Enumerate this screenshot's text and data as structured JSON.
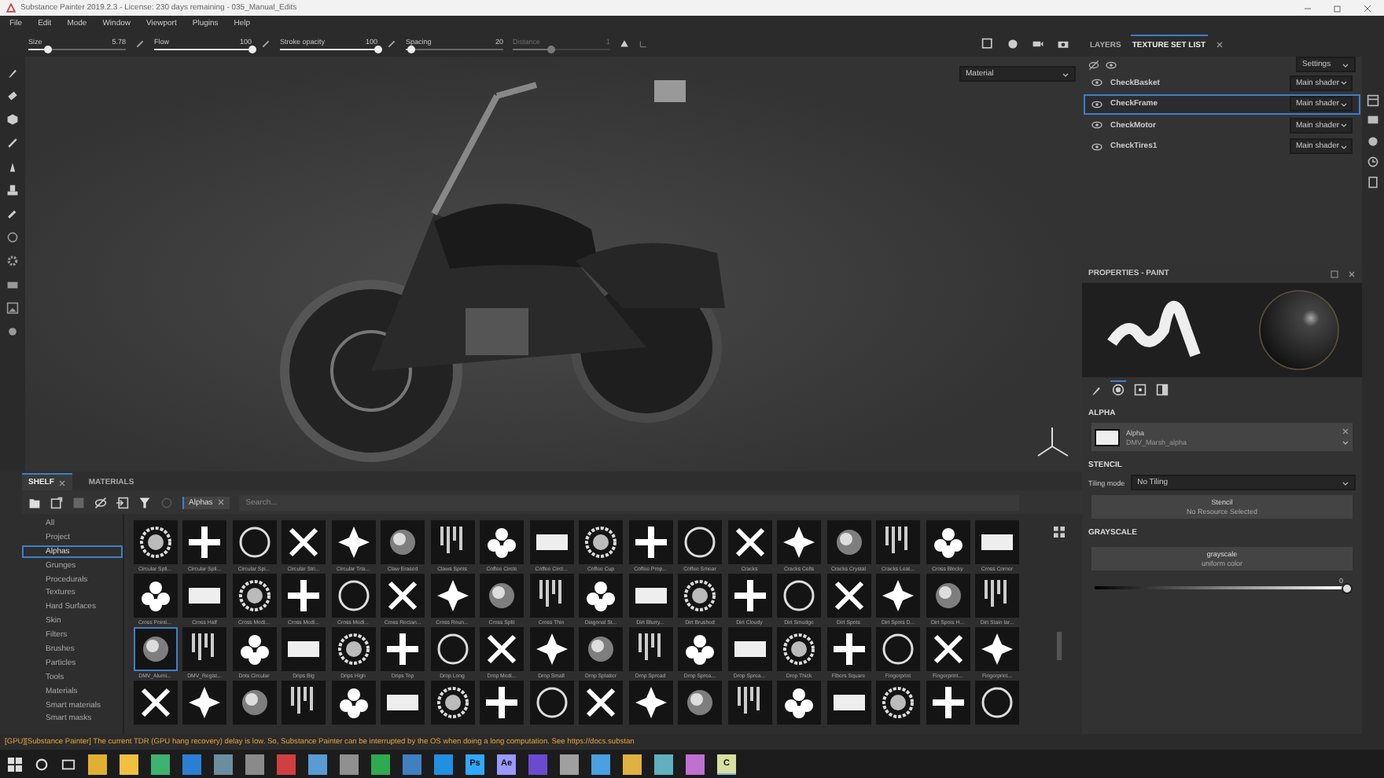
{
  "window": {
    "title": "Substance Painter 2019.2.3 - License: 230 days remaining - 035_Manual_Edits"
  },
  "menu": [
    "File",
    "Edit",
    "Mode",
    "Window",
    "Viewport",
    "Plugins",
    "Help"
  ],
  "toolbar": {
    "sliders": [
      {
        "label": "Size",
        "reading": "5.78",
        "level": 0.2,
        "disabled": false
      },
      {
        "label": "Flow",
        "reading": "100",
        "level": 1,
        "disabled": false
      },
      {
        "label": "Stroke opacity",
        "reading": "100",
        "level": 1,
        "disabled": false
      },
      {
        "label": "Spacing",
        "reading": "20",
        "level": 0.05,
        "disabled": false
      },
      {
        "label": "Distance",
        "reading": "1",
        "level": 0.4,
        "disabled": true
      }
    ]
  },
  "viewport": {
    "display_mode": "Material"
  },
  "panel_tabs": [
    {
      "label": "LAYERS",
      "selected": false
    },
    {
      "label": "TEXTURE SET LIST",
      "selected": true
    }
  ],
  "texture_sets": {
    "settings": "Settings",
    "rows": [
      {
        "name": "CheckBasket",
        "shader": "Main shader",
        "selected": false
      },
      {
        "name": "CheckFrame",
        "shader": "Main shader",
        "selected": true
      },
      {
        "name": "CheckMotor",
        "shader": "Main shader",
        "selected": false
      },
      {
        "name": "CheckTires1",
        "shader": "Main shader",
        "selected": false
      }
    ]
  },
  "properties": {
    "title": "PROPERTIES - PAINT",
    "tabs": [
      {
        "kind": "brush",
        "selected": false
      },
      {
        "kind": "alpha",
        "selected": true
      },
      {
        "kind": "stencil",
        "selected": false
      },
      {
        "kind": "material",
        "selected": false
      }
    ],
    "alpha": {
      "heading": "ALPHA",
      "name": "Alpha",
      "resource": "DMV_Marsh_alpha"
    },
    "stencil": {
      "heading": "STENCIL",
      "tiling_label": "Tiling mode",
      "tiling_value": "No Tiling",
      "button_title": "Stencil",
      "button_subtitle": "No Resource Selected"
    },
    "grayscale": {
      "heading": "GRAYSCALE",
      "button_title": "grayscale",
      "button_subtitle": "uniform color",
      "reading": "0",
      "level": 1
    }
  },
  "shelf": {
    "tabs": [
      {
        "label": "SHELF",
        "selected": true,
        "closable": true
      },
      {
        "label": "MATERIALS",
        "selected": false,
        "closable": false
      }
    ],
    "filter": "Alphas",
    "search": {
      "placeholder": "Search..."
    },
    "categories": [
      {
        "label": "All",
        "selected": false
      },
      {
        "label": "Project",
        "selected": false
      },
      {
        "label": "Alphas",
        "selected": true
      },
      {
        "label": "Grunges",
        "selected": false
      },
      {
        "label": "Procedurals",
        "selected": false
      },
      {
        "label": "Textures",
        "selected": false
      },
      {
        "label": "Hard Surfaces",
        "selected": false
      },
      {
        "label": "Skin",
        "selected": false
      },
      {
        "label": "Filters",
        "selected": false
      },
      {
        "label": "Brushes",
        "selected": false
      },
      {
        "label": "Particles",
        "selected": false
      },
      {
        "label": "Tools",
        "selected": false
      },
      {
        "label": "Materials",
        "selected": false
      },
      {
        "label": "Smart materials",
        "selected": false
      },
      {
        "label": "Smart masks",
        "selected": false
      }
    ],
    "rows": [
      {
        "tiles": [
          {
            "label": "Circular Spli...",
            "selected": false
          },
          {
            "label": "Circular Spli...",
            "selected": false
          },
          {
            "label": "Circular Spi...",
            "selected": false
          },
          {
            "label": "Circular Stri...",
            "selected": false
          },
          {
            "label": "Circular Tria...",
            "selected": false
          },
          {
            "label": "Claw Erased",
            "selected": false
          },
          {
            "label": "Claws Spots",
            "selected": false
          },
          {
            "label": "Coffee Circle",
            "selected": false
          },
          {
            "label": "Coffee Circl...",
            "selected": false
          },
          {
            "label": "Coffee Cup",
            "selected": false
          },
          {
            "label": "Coffee Prop...",
            "selected": false
          },
          {
            "label": "Coffee Smear",
            "selected": false
          },
          {
            "label": "Cracks",
            "selected": false
          },
          {
            "label": "Cracks Cells",
            "selected": false
          },
          {
            "label": "Cracks Crystal",
            "selected": false
          },
          {
            "label": "Cracks Leat...",
            "selected": false
          },
          {
            "label": "Cross Blocky",
            "selected": false
          },
          {
            "label": "Cross Corner",
            "selected": false
          }
        ]
      },
      {
        "tiles": [
          {
            "label": "Cross Pointi...",
            "selected": false
          },
          {
            "label": "Cross Half",
            "selected": false
          },
          {
            "label": "Cross Medi...",
            "selected": false
          },
          {
            "label": "Cross Medi...",
            "selected": false
          },
          {
            "label": "Cross Medi...",
            "selected": false
          },
          {
            "label": "Cross Rectan...",
            "selected": false
          },
          {
            "label": "Cross Roun...",
            "selected": false
          },
          {
            "label": "Cross Split",
            "selected": false
          },
          {
            "label": "Cross Thin",
            "selected": false
          },
          {
            "label": "Diagonal St...",
            "selected": false
          },
          {
            "label": "Dirt Blurry...",
            "selected": false
          },
          {
            "label": "Dirt Brushed",
            "selected": false
          },
          {
            "label": "Dirt Cloudy",
            "selected": false
          },
          {
            "label": "Dirt Smudge",
            "selected": false
          },
          {
            "label": "Dirt Spots",
            "selected": false
          },
          {
            "label": "Dirt Spots D...",
            "selected": false
          },
          {
            "label": "Dirt Spots H...",
            "selected": false
          },
          {
            "label": "Dirt Stain lar...",
            "selected": false
          }
        ]
      },
      {
        "tiles": [
          {
            "label": "DMV_Alumi...",
            "selected": true
          },
          {
            "label": "DMV_Regist...",
            "selected": false
          },
          {
            "label": "Dots Circular",
            "selected": false
          },
          {
            "label": "Drips Big",
            "selected": false
          },
          {
            "label": "Drips High",
            "selected": false
          },
          {
            "label": "Drips Top",
            "selected": false
          },
          {
            "label": "Drop Long",
            "selected": false
          },
          {
            "label": "Drop Medi...",
            "selected": false
          },
          {
            "label": "Drop Small",
            "selected": false
          },
          {
            "label": "Drop Splatter",
            "selected": false
          },
          {
            "label": "Drop Spread",
            "selected": false
          },
          {
            "label": "Drop Sprea...",
            "selected": false
          },
          {
            "label": "Drop Sprea...",
            "selected": false
          },
          {
            "label": "Drop Thick",
            "selected": false
          },
          {
            "label": "Fibers Square",
            "selected": false
          },
          {
            "label": "Fingerprint",
            "selected": false
          },
          {
            "label": "Fingerprint...",
            "selected": false
          },
          {
            "label": "Fingerprint...",
            "selected": false
          }
        ]
      },
      {
        "tiles": [
          {
            "selected": false
          },
          {
            "selected": false
          },
          {
            "selected": false
          },
          {
            "selected": false
          },
          {
            "selected": false
          },
          {
            "selected": false
          },
          {
            "selected": false
          },
          {
            "selected": false
          },
          {
            "selected": false
          },
          {
            "selected": false
          },
          {
            "selected": false
          },
          {
            "selected": false
          },
          {
            "selected": false
          },
          {
            "selected": false
          },
          {
            "selected": false
          },
          {
            "selected": false
          },
          {
            "selected": false
          },
          {
            "selected": false
          }
        ]
      }
    ]
  },
  "status_bar": {
    "message": "[GPU][Substance Painter] The current TDR (GPU hang recovery) delay is low. So, Substance Painter can be interrupted by the OS when doing a long computation. See https://docs.substan"
  },
  "taskbar": {
    "items": [
      {
        "kind": "start"
      },
      {
        "kind": "search"
      },
      {
        "kind": "taskview"
      },
      {
        "kind": "app",
        "color": "#e0b030",
        "selected": false
      },
      {
        "kind": "app",
        "color": "#f0c040",
        "selected": false
      },
      {
        "kind": "app",
        "color": "#3cb371",
        "selected": false
      },
      {
        "kind": "app",
        "color": "#2a7fd4",
        "selected": false
      },
      {
        "kind": "app",
        "color": "#6b8e9f",
        "selected": false
      },
      {
        "kind": "app",
        "color": "#8a8a8a",
        "selected": false
      },
      {
        "kind": "app",
        "color": "#d04040",
        "selected": false
      },
      {
        "kind": "app",
        "color": "#5a9bd4",
        "selected": false
      },
      {
        "kind": "app",
        "color": "#909090",
        "selected": false
      },
      {
        "kind": "app",
        "color": "#2eaa50",
        "selected": false
      },
      {
        "kind": "app",
        "color": "#4080c0",
        "selected": false
      },
      {
        "kind": "app",
        "color": "#2090e0",
        "selected": false
      },
      {
        "kind": "app",
        "color": "#31a8ff",
        "label": "Ps",
        "selected": false
      },
      {
        "kind": "app",
        "color": "#9999ff",
        "label": "Ae",
        "selected": false
      },
      {
        "kind": "app",
        "color": "#6a4bd0",
        "selected": false
      },
      {
        "kind": "app",
        "color": "#a0a0a0",
        "selected": false
      },
      {
        "kind": "app",
        "color": "#4aa0e0",
        "selected": false
      },
      {
        "kind": "app",
        "color": "#e0b040",
        "selected": false
      },
      {
        "kind": "app",
        "color": "#60b0c0",
        "selected": false
      },
      {
        "kind": "app",
        "color": "#c070d0",
        "selected": false
      },
      {
        "kind": "app",
        "color": "#d8e0a0",
        "label": "C",
        "selected": true
      }
    ]
  }
}
